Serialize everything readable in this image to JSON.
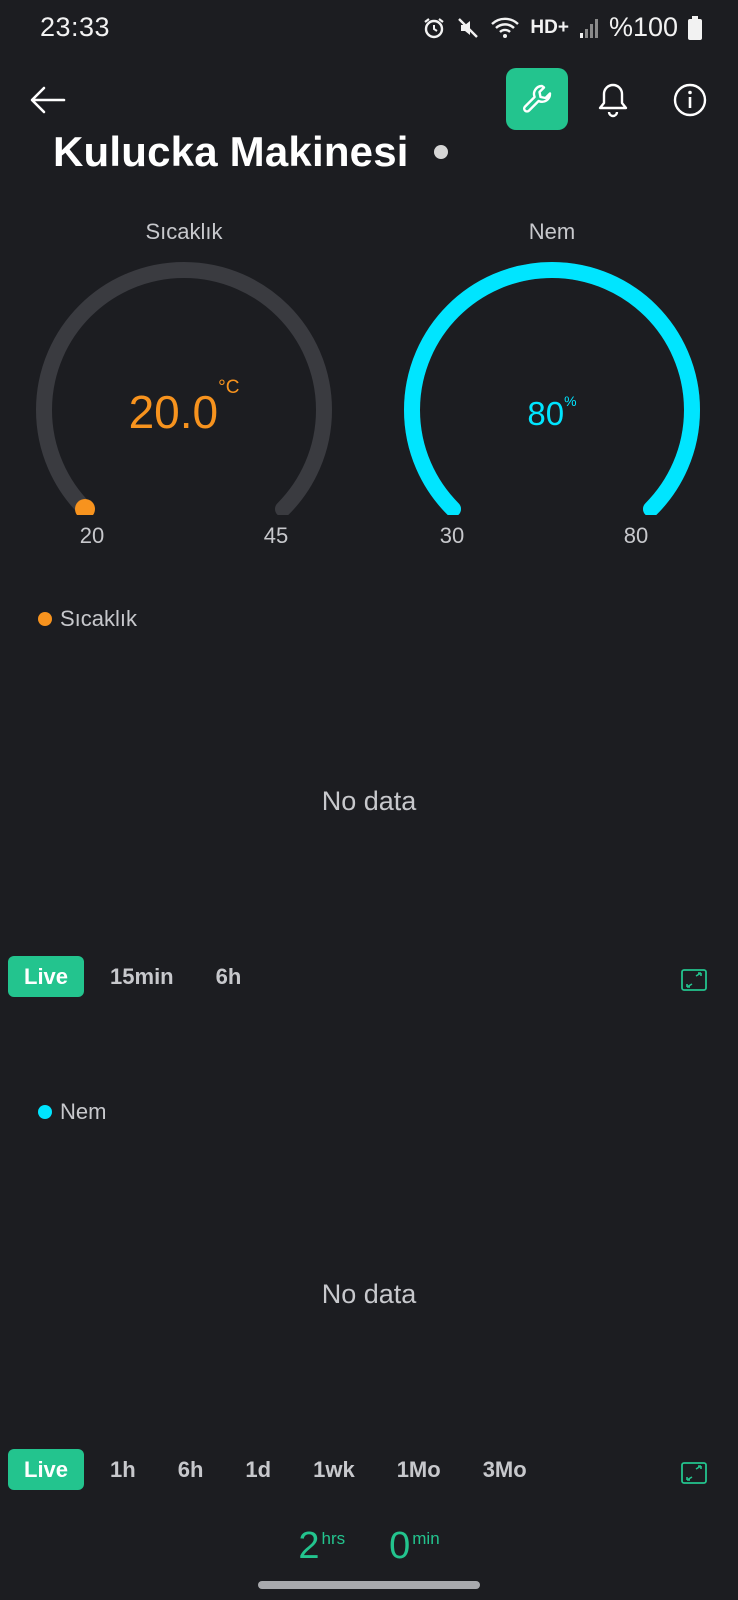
{
  "status_bar": {
    "time": "23:33",
    "battery_text": "%100",
    "network_label": "HD+"
  },
  "header": {
    "title": "Kulucka Makinesi"
  },
  "gauges": [
    {
      "label": "Sıcaklık",
      "value": "20.0",
      "unit": "°C",
      "min": "20",
      "max": "45",
      "level": 0.0,
      "color": "#f7931e",
      "track_color": "#3a3b40"
    },
    {
      "label": "Nem",
      "value": "80",
      "unit": "%",
      "min": "30",
      "max": "80",
      "level": 1.0,
      "color": "#00e5ff",
      "track_color": "#3a3b40"
    }
  ],
  "charts": [
    {
      "legend": "Sıcaklık",
      "color": "#f7931e",
      "message": "No data",
      "ranges": [
        "Live",
        "15min",
        "6h"
      ],
      "active_range": "Live"
    },
    {
      "legend": "Nem",
      "color": "#00e5ff",
      "message": "No data",
      "ranges": [
        "Live",
        "1h",
        "6h",
        "1d",
        "1wk",
        "1Mo",
        "3Mo"
      ],
      "active_range": "Live"
    }
  ],
  "timer": {
    "hours": "2",
    "hours_unit": "hrs",
    "minutes": "0",
    "minutes_unit": "min"
  },
  "colors": {
    "background": "#1c1d21",
    "accent": "#23c48e"
  }
}
